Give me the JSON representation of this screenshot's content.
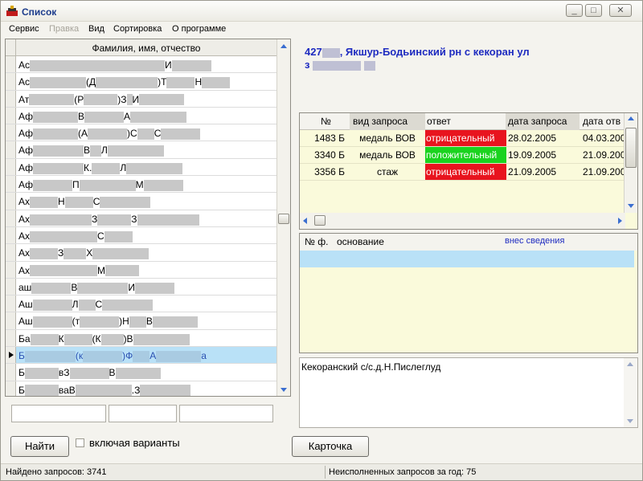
{
  "window": {
    "title": "Список",
    "min_label": "_",
    "max_label": "□",
    "close_label": "✕"
  },
  "menu": {
    "items": [
      "Сервис",
      "Правка",
      "Вид",
      "Сортировка",
      "О программе"
    ],
    "disabled": [
      false,
      true,
      false,
      false,
      false
    ]
  },
  "list": {
    "header": "Фамилия, имя, отчество",
    "rows": [
      "Ас ■■■■■■■■■■ ■■■■■■■■ ■■■■■■ И ■■■■■■■",
      "Ас ■■■■■■■■■■ (Д ■■■■■■■■■■■) Т ■■■■■ Н ■■■■■",
      "Ат ■■■■■■■■ (Р ■■■■■■) З ■ И ■■■■■■■■",
      "Аф ■■■■■■■■ В ■■■■■■■ А ■■■■■■■■■■",
      "Аф ■■■■■■■■ (А ■■■■■■■) С ■■■ С ■■■■■■■",
      "Аф ■■■■■■■■■ В ■■ Л ■■■■■■■■■■",
      "Аф ■■■■■■■■■ К. ■■■■■ Л ■■■■■■■■■■",
      "Аф ■■■■■■■ П ■■■■■■■■■■ М ■■■■■■■",
      "Ах ■■■■■ Н ■■■■■ С ■■■■■■■■■",
      "Ах ■■■■■■■■■■■ З ■■■■■■ З ■■■■■■■■■■■",
      "Ах ■■■■■■■■■■■■ С ■■■■■",
      "Ах ■■■■■ З ■■■■ Х ■■■■■■■■■■",
      "Ах ■■■■■■■■■■■■ М ■■■■■■",
      "аш ■■■■■■■ В ■■■■■■■■■ И ■■■■■■■",
      "Аш ■■■■■■■ Л ■■■ С ■■■■■■■■■",
      "Аш ■■■■■■■ (т ■■■■■■■) Н ■■■ В ■■■■■■■■",
      "Ба ■■■■■ К ■■■■■ (К ■■■■) В ■■■■■■■■■■",
      "Б ■■■■■■■■■ (к ■■■■■■■) Ф ■■■ А ■■■■■■■■ а",
      "Б ■■■■■■ в З ■■■■■■■ В ■■■■■■■■",
      "Б ■■■■■■ ва В ■■■■■■■■■■. З ■■■■■■■■■"
    ],
    "selected_index": 17
  },
  "address": {
    "line1_prefix": "427",
    "line1_text": ", Якшур-Бодьинский рн с кекоран  ул",
    "line2_prefix": "з"
  },
  "requests": {
    "columns": [
      "№",
      "вид запроса",
      "ответ",
      "дата запроса",
      "дата отв"
    ],
    "rows": [
      {
        "num": "1483 Б",
        "type": "медаль ВОВ",
        "answer": "отрицательный",
        "answer_color": "#e8141e",
        "date_req": "28.02.2005",
        "date_ans": "04.03.200"
      },
      {
        "num": "3340 Б",
        "type": "медаль ВОВ",
        "answer": "положительный",
        "answer_color": "#1bd31f",
        "date_req": "19.09.2005",
        "date_ans": "21.09.200"
      },
      {
        "num": "3356 Б",
        "type": "стаж",
        "answer": "отрицательный",
        "answer_color": "#e8141e",
        "date_req": "21.09.2005",
        "date_ans": "21.09.200"
      }
    ]
  },
  "basis": {
    "col_num": "№ ф.",
    "col_basis": "основание",
    "col_entered": "внес сведения"
  },
  "memo": {
    "text": "Кекоранский с/с.д.Н.Пислеглуд"
  },
  "buttons": {
    "find": "Найти",
    "variants": "включая варианты",
    "card": "Карточка"
  },
  "status": {
    "found": "Найдено запросов: 3741",
    "pending": "Неисполненных запросов за год: 75"
  },
  "colors": {
    "selection": "#b9e1f7",
    "grid_bg": "#fafadb",
    "address": "#1e2bc0",
    "title": "#1c3c8c"
  }
}
